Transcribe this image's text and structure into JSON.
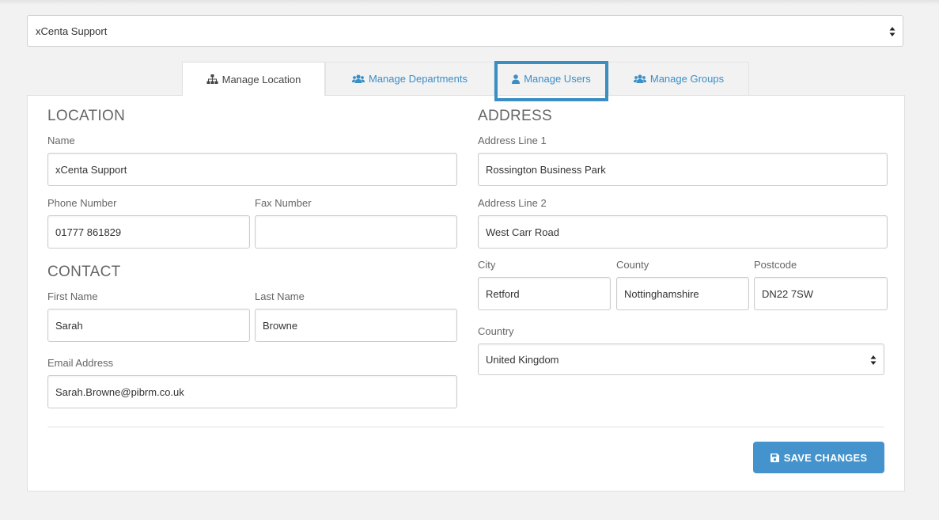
{
  "location_selector": {
    "value": "xCenta Support"
  },
  "tabs": [
    {
      "label": "Manage Location",
      "icon": "sitemap-icon",
      "active": true
    },
    {
      "label": "Manage Departments",
      "icon": "users-icon",
      "active": false
    },
    {
      "label": "Manage Users",
      "icon": "user-icon",
      "active": false
    },
    {
      "label": "Manage Groups",
      "icon": "users-icon",
      "active": false
    }
  ],
  "location": {
    "heading": "LOCATION",
    "name_label": "Name",
    "name_value": "xCenta Support",
    "phone_label": "Phone Number",
    "phone_value": "01777 861829",
    "fax_label": "Fax Number",
    "fax_value": ""
  },
  "contact": {
    "heading": "CONTACT",
    "first_name_label": "First Name",
    "first_name_value": "Sarah",
    "last_name_label": "Last Name",
    "last_name_value": "Browne",
    "email_label": "Email Address",
    "email_value": "Sarah.Browne@pibrm.co.uk"
  },
  "address": {
    "heading": "ADDRESS",
    "line1_label": "Address Line 1",
    "line1_value": "Rossington Business Park",
    "line2_label": "Address Line 2",
    "line2_value": "West Carr Road",
    "city_label": "City",
    "city_value": "Retford",
    "county_label": "County",
    "county_value": "Nottinghamshire",
    "postcode_label": "Postcode",
    "postcode_value": "DN22 7SW",
    "country_label": "Country",
    "country_value": "United Kingdom"
  },
  "actions": {
    "save_label": "SAVE CHANGES",
    "save_icon": "floppy-disk-icon"
  },
  "colors": {
    "accent": "#4593cc",
    "highlight": "#3b8ec4",
    "tab_link": "#3a8fc7"
  }
}
